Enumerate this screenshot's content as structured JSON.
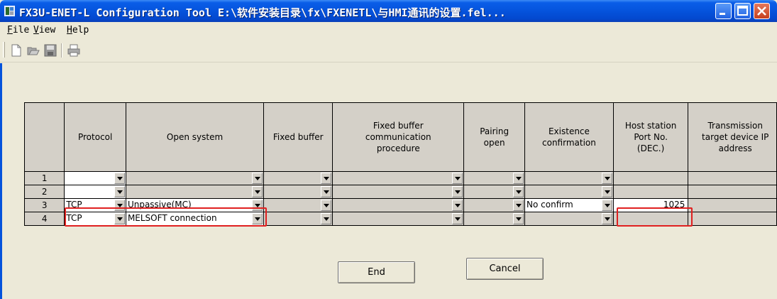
{
  "window": {
    "title": "FX3U-ENET-L Configuration Tool E:\\软件安装目录\\fx\\FXENETL\\与HMI通讯的设置.fel...",
    "colors": {
      "titlebar": "#0553dc",
      "highlight": "#e02020",
      "face": "#d4d0c8"
    }
  },
  "menu": {
    "items": [
      {
        "key": "F",
        "rest": "ile"
      },
      {
        "key": "V",
        "rest": "iew"
      },
      {
        "key": "H",
        "rest": "elp"
      }
    ]
  },
  "toolbar": {
    "icons": [
      "new-icon",
      "open-icon",
      "save-icon",
      "print-icon"
    ]
  },
  "table": {
    "headers": [
      "Protocol",
      "Open system",
      "Fixed buffer",
      "Fixed buffer communication procedure",
      "Pairing open",
      "Existence confirmation",
      "Host station Port No. (DEC.)",
      "Transmission target device IP address"
    ],
    "rows": [
      {
        "num": "1",
        "protocol": "",
        "open_system": "",
        "fixed_buffer": "",
        "procedure": "",
        "pairing": "",
        "existence": "",
        "port": "",
        "target": ""
      },
      {
        "num": "2",
        "protocol": "",
        "open_system": "",
        "fixed_buffer": "",
        "procedure": "",
        "pairing": "",
        "existence": "",
        "port": "",
        "target": ""
      },
      {
        "num": "3",
        "protocol": "TCP",
        "open_system": "Unpassive(MC)",
        "fixed_buffer": "",
        "procedure": "",
        "pairing": "",
        "existence": "No confirm",
        "port": "1025",
        "target": ""
      },
      {
        "num": "4",
        "protocol": "TCP",
        "open_system": "MELSOFT connection",
        "fixed_buffer": "",
        "procedure": "",
        "pairing": "",
        "existence": "",
        "port": "",
        "target": ""
      }
    ]
  },
  "buttons": {
    "end": "End",
    "cancel": "Cancel"
  }
}
